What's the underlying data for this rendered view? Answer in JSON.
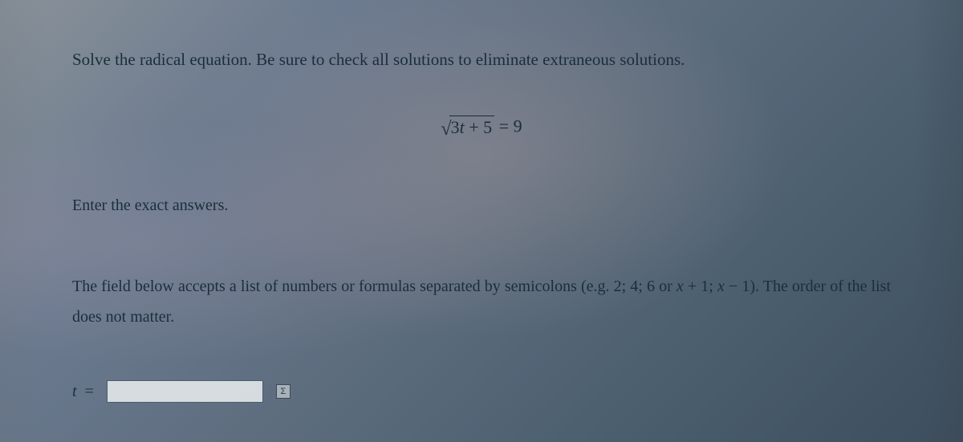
{
  "instruction_top": "Solve the radical equation. Be sure to check all solutions to eliminate extraneous solutions.",
  "equation": {
    "sqrt_inner_var": "t",
    "sqrt_inner_coeff": "3",
    "sqrt_inner_op": " + ",
    "sqrt_inner_const": "5",
    "rhs_op": " = ",
    "rhs_val": "9"
  },
  "sub_instruction": "Enter the exact answers.",
  "field_instruction_part1": "The field below accepts a list of numbers or formulas separated by semicolons (e.g. ",
  "field_instruction_ex1": "2; 4; 6",
  "field_instruction_or": " or ",
  "field_instruction_ex2a": "x",
  "field_instruction_ex2b": " + 1; ",
  "field_instruction_ex2c": "x",
  "field_instruction_ex2d": " − 1",
  "field_instruction_part2": "). The order of the list does not matter.",
  "answer_var": "t",
  "answer_equals": "=",
  "answer_value": "",
  "eq_icon_glyph": "Σ"
}
